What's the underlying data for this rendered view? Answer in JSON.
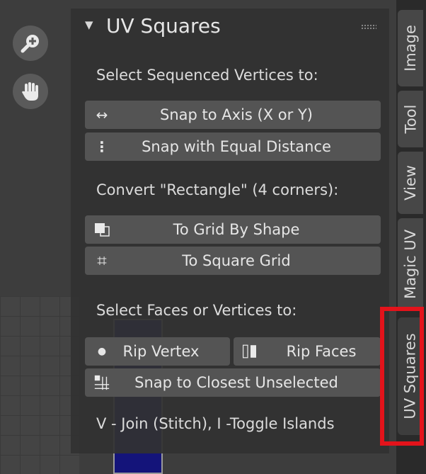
{
  "panel": {
    "title": "UV Squares",
    "collapse_glyph": "▼",
    "section1_label": "Select Sequenced Vertices to:",
    "snap_axis": {
      "label": "Snap to Axis (X or Y)",
      "icon": "↔"
    },
    "snap_equal": {
      "label": "Snap with Equal Distance",
      "icon": "⋮"
    },
    "section2_label": "Convert \"Rectangle\" (4 corners):",
    "grid_by_shape": {
      "label": "To Grid By Shape"
    },
    "square_grid": {
      "label": "To Square Grid",
      "icon": "⌗"
    },
    "section3_label": "Select Faces or Vertices to:",
    "rip_vertex": {
      "label": "Rip Vertex",
      "icon": "●"
    },
    "rip_faces": {
      "label": "Rip Faces"
    },
    "snap_closest": {
      "label": "Snap to Closest Unselected"
    },
    "hint": "V - Join (Stitch), I -Toggle Islands"
  },
  "tabs": [
    "Image",
    "Tool",
    "View",
    "Magic UV",
    "UV Squares"
  ],
  "active_tab": "UV Squares",
  "nav_icons": [
    "zoom-icon",
    "hand-icon"
  ],
  "colors": {
    "highlight": "#e3131b",
    "button": "#545454",
    "uv_face": "#14147a"
  }
}
